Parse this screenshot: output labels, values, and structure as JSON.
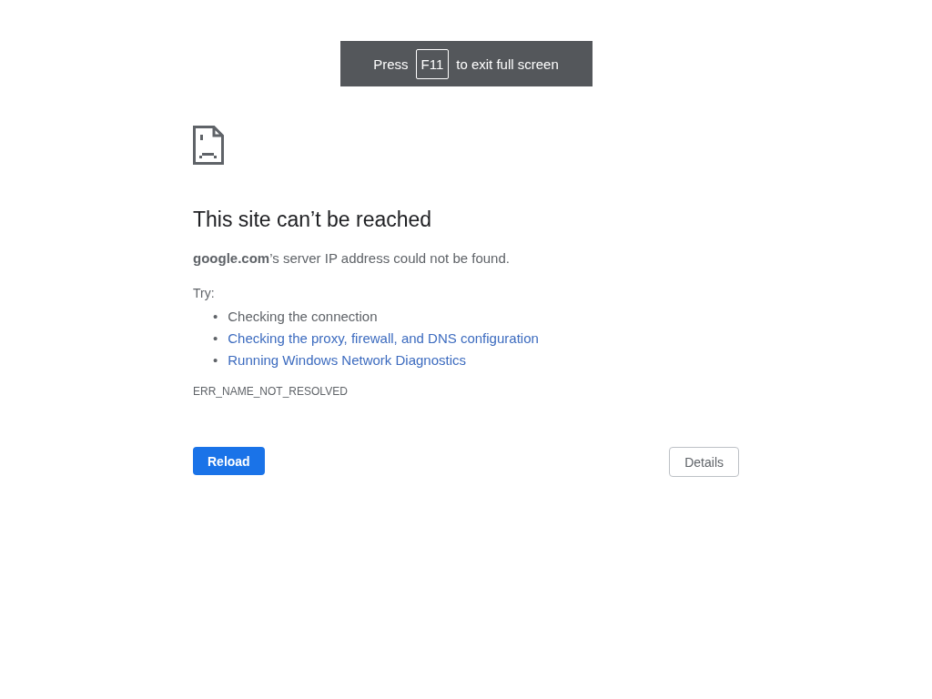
{
  "fullscreen_banner": {
    "before": "Press",
    "key": "F11",
    "after": "to exit full screen"
  },
  "heading": "This site can’t be reached",
  "summary": "**google.com**’s server IP address could not be found.",
  "try_label": "Try:",
  "suggestions": [
    {
      "kind": "text",
      "marker": "•",
      "text": "Checking the connection"
    },
    {
      "kind": "link",
      "marker": "•",
      "text": "Checking the proxy, firewall, and DNS configuration"
    },
    {
      "kind": "link",
      "marker": "•",
      "text": "Running Windows Network Diagnostics"
    }
  ],
  "error_code": "ERR_NAME_NOT_RESOLVED",
  "buttons": {
    "reload": "Reload",
    "details": "Details"
  }
}
